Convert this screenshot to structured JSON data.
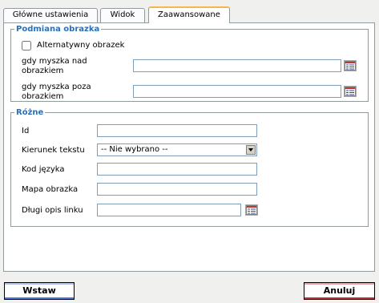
{
  "tabs": [
    {
      "label": "Główne ustawienia",
      "active": false
    },
    {
      "label": "Widok",
      "active": false
    },
    {
      "label": "Zaawansowane",
      "active": true
    }
  ],
  "image_swap": {
    "legend": "Podmiana obrazka",
    "alt_image_label": "Alternatywny obrazek",
    "alt_image_checked": false,
    "mouse_over_label_1": "gdy myszka nad",
    "mouse_over_label_2": "obrazkiem",
    "mouse_over_value": "",
    "mouse_out_label_1": "gdy myszka poza",
    "mouse_out_label_2": "obrazkiem",
    "mouse_out_value": ""
  },
  "misc": {
    "legend": "Różne",
    "id_label": "Id",
    "id_value": "",
    "text_direction_label": "Kierunek tekstu",
    "text_direction_value": "-- Nie wybrano --",
    "lang_code_label": "Kod języka",
    "lang_code_value": "",
    "image_map_label": "Mapa obrazka",
    "image_map_value": "",
    "long_desc_label": "Długi opis linku",
    "long_desc_value": ""
  },
  "buttons": {
    "insert": "Wstaw",
    "cancel": "Anuluj"
  },
  "icons": {
    "browse": "file-browser-icon"
  }
}
